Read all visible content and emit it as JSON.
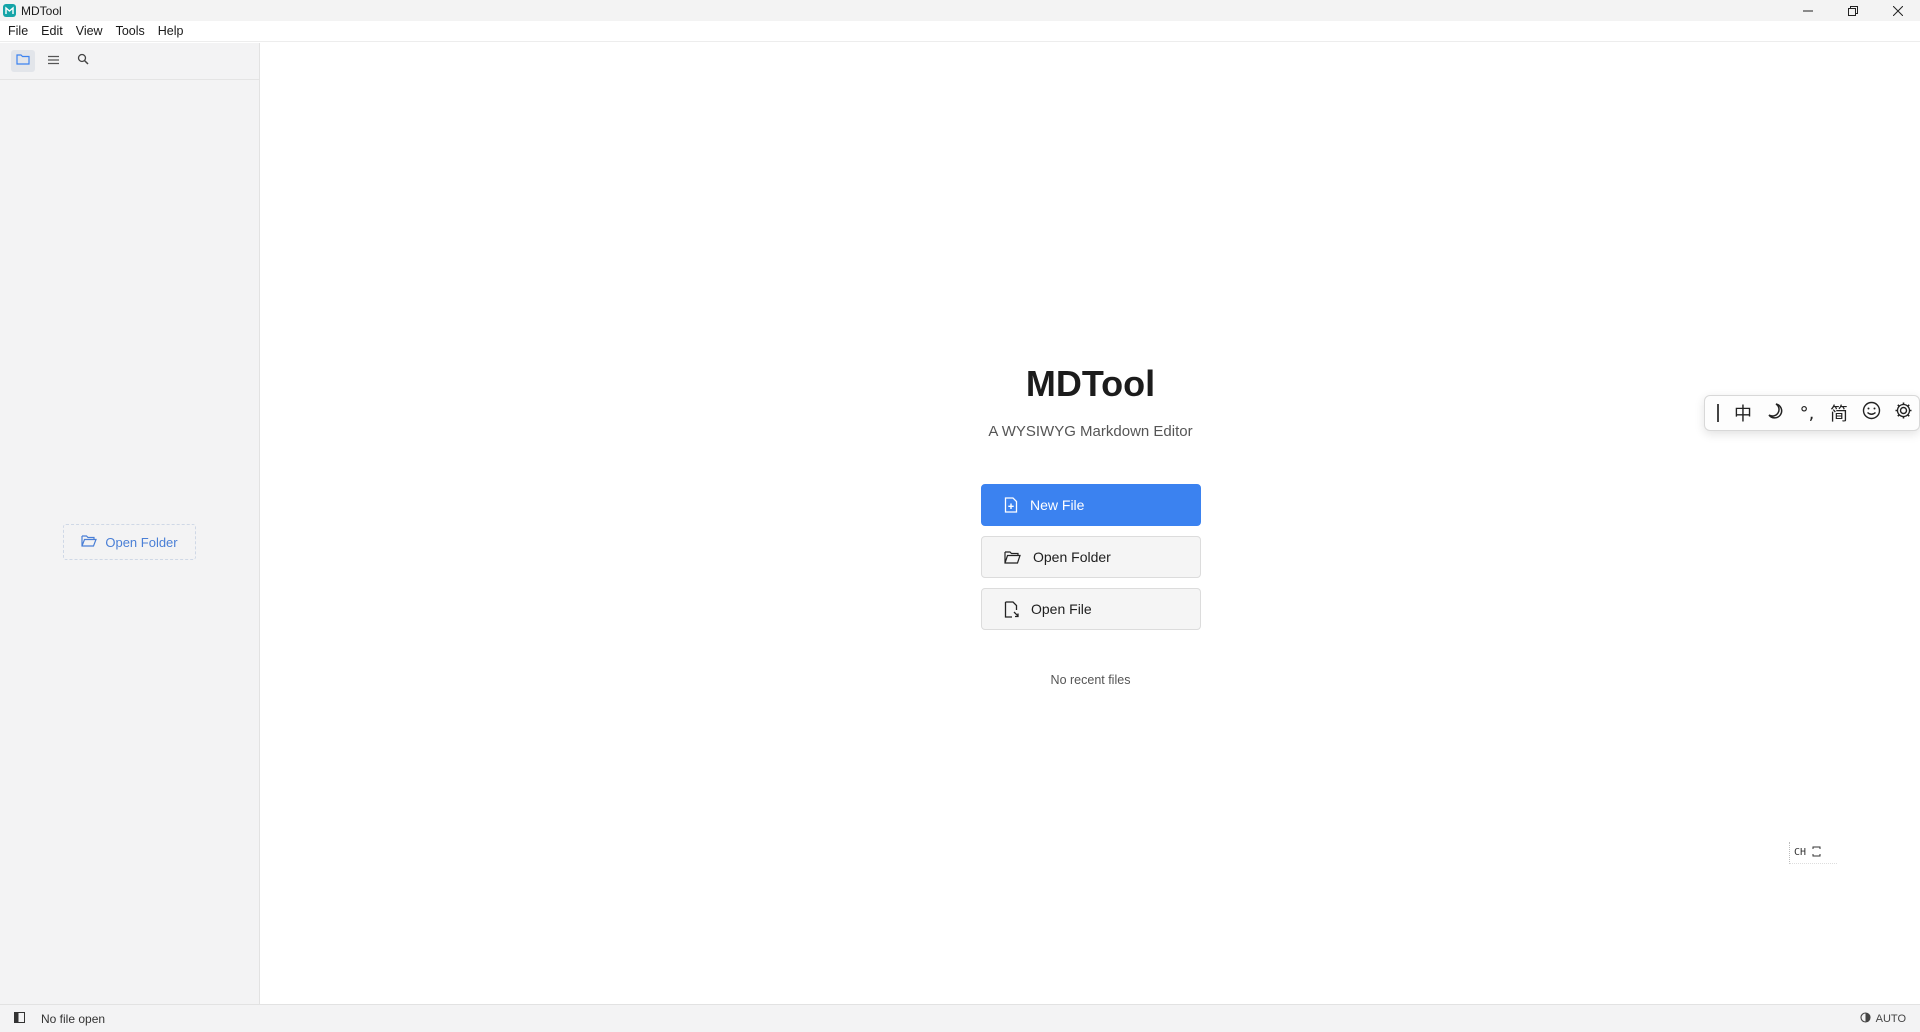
{
  "window": {
    "title": "MDTool",
    "controls": [
      "minimize",
      "restore",
      "close"
    ]
  },
  "menubar": {
    "items": [
      "File",
      "Edit",
      "View",
      "Tools",
      "Help"
    ]
  },
  "sidebar": {
    "tabs": [
      {
        "icon": "folder-icon",
        "active": true
      },
      {
        "icon": "outline-icon",
        "active": false
      },
      {
        "icon": "search-icon",
        "active": false
      }
    ],
    "open_folder_label": "Open Folder"
  },
  "welcome": {
    "title": "MDTool",
    "subtitle": "A WYSIWYG Markdown Editor",
    "new_file_label": "New File",
    "open_folder_label": "Open Folder",
    "open_file_label": "Open File",
    "recent_text": "No recent files"
  },
  "ime_toolbar": {
    "chinese_mode": "中",
    "punctuation": "°,",
    "simplified": "简",
    "mini_label": "CH"
  },
  "statusbar": {
    "file_status": "No file open",
    "theme_mode": "AUTO"
  },
  "colors": {
    "accent": "#3b82f0",
    "logo": "#16a5a8",
    "sidebar_bg": "#f3f3f4"
  }
}
